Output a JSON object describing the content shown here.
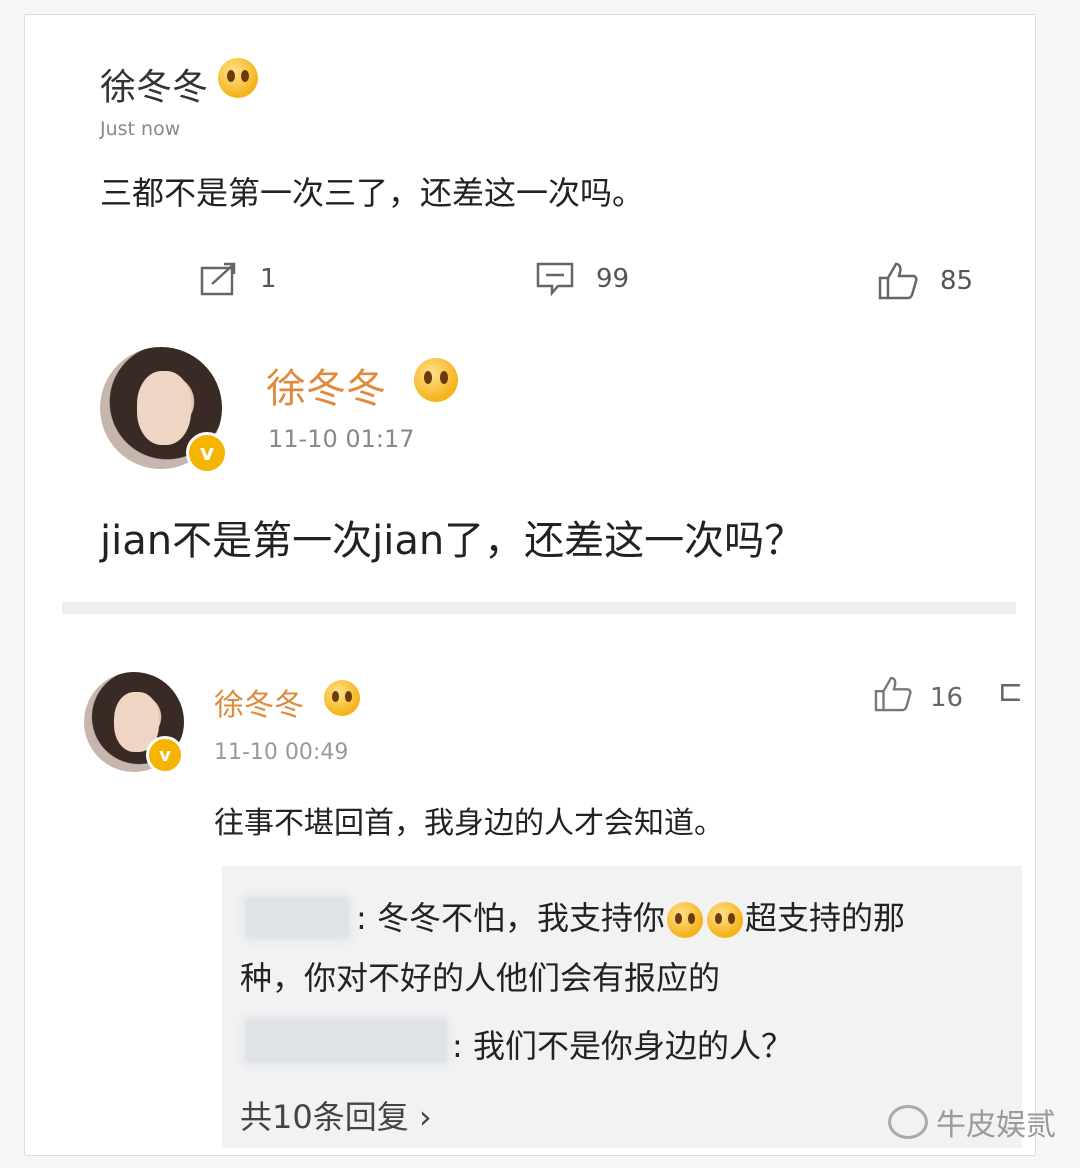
{
  "post1": {
    "username": "徐冬冬",
    "emoji_icon": "cute-emoji-icon",
    "time": "Just now",
    "text": "三都不是第一次三了，还差这一次吗。",
    "actions": {
      "repost": "1",
      "comments": "99",
      "likes": "85"
    }
  },
  "post2": {
    "username": "徐冬冬",
    "time": "11-10 01:17",
    "text": "jian不是第一次jian了，还差这一次吗？"
  },
  "comment": {
    "username": "徐冬冬",
    "time": "11-10 00:49",
    "likes": "16",
    "text": "往事不堪回首，我身边的人才会知道。",
    "replies": [
      {
        "text_part1": ": 冬冬不怕，我支持你",
        "text_part2": "超支持的那",
        "text_line2": "种，你对不好的人他们会有报应的"
      },
      {
        "text": ": 我们不是你身边的人？"
      }
    ],
    "reply_count_label": "共10条回复 ›"
  },
  "watermark": "牛皮娱贰",
  "colors": {
    "username_gold": "#e08a3c",
    "badge_gold": "#f4b400"
  }
}
